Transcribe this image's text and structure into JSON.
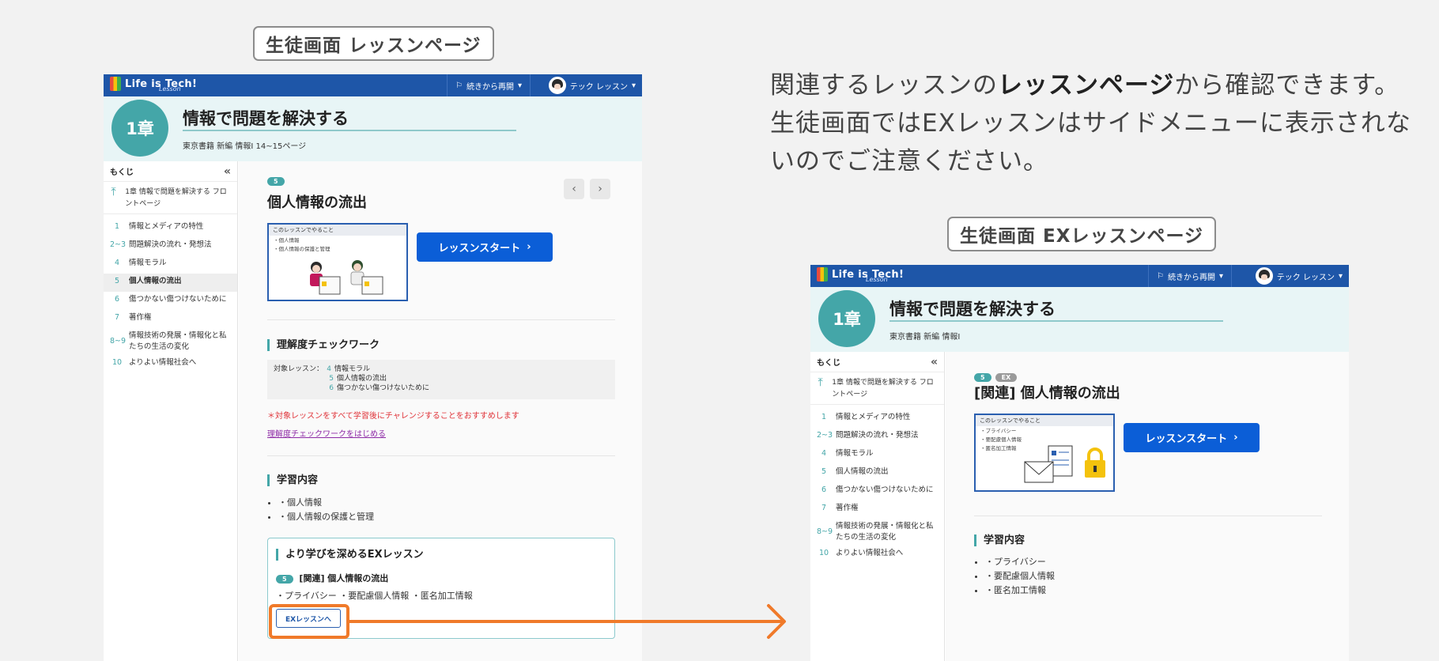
{
  "captions": {
    "left": "生徒画面 レッスンページ",
    "right": "生徒画面 EXレッスンページ"
  },
  "description": {
    "pre": "関連するレッスンの",
    "bold": "レッスンページ",
    "post": "から確認できます。生徒画面ではEXレッスンはサイドメニューに表示されないのでご注意ください。"
  },
  "header": {
    "logo": "Life is Tech!",
    "logo_sub": "Lesson",
    "resume": "続きから再開",
    "user": "テック レッスン",
    "chapter": "1章",
    "chapter_title": "情報で問題を解決する"
  },
  "left": {
    "book": "東京書籍 新編 情報Ⅰ 14~15ページ",
    "lesson_num": "5",
    "lesson_title": "個人情報の流出",
    "thumb_title": "このレッスンでやること",
    "thumb_lines": [
      "・個人情報",
      "・個人情報の保護と管理"
    ],
    "start": "レッスンスタート",
    "check_title": "理解度チェックワーク",
    "target_label": "対象レッスン：",
    "targets": [
      {
        "num": "4",
        "name": "情報モラル"
      },
      {
        "num": "5",
        "name": "個人情報の流出"
      },
      {
        "num": "6",
        "name": "傷つかない傷つけないために"
      }
    ],
    "warning": "＊対象レッスンをすべて学習後にチャレンジすることをおすすめします",
    "check_link": "理解度チェックワークをはじめる",
    "content_title": "学習内容",
    "contents": [
      "・個人情報",
      "・個人情報の保護と管理"
    ],
    "ex_title": "より学びを深めるEXレッスン",
    "ex_num": "5",
    "ex_lesson": "[関連] 個人情報の流出",
    "ex_tags": "・プライバシー ・要配慮個人情報 ・匿名加工情報",
    "ex_button": "EXレッスンへ"
  },
  "right": {
    "book": "東京書籍 新編 情報Ⅰ",
    "lesson_num": "5",
    "ex_badge": "EX",
    "lesson_title": "[関連] 個人情報の流出",
    "thumb_title": "このレッスンでやること",
    "thumb_lines": [
      "・プライバシー",
      "・要配慮個人情報",
      "・匿名加工情報"
    ],
    "start": "レッスンスタート",
    "content_title": "学習内容",
    "contents": [
      "・プライバシー",
      "・要配慮個人情報",
      "・匿名加工情報"
    ]
  },
  "sidebar": {
    "heading": "もくじ",
    "front": "1章 情報で問題を解決する フロントページ",
    "items": [
      {
        "num": "1",
        "label": "情報とメディアの特性"
      },
      {
        "num": "2~3",
        "label": "問題解決の流れ・発想法"
      },
      {
        "num": "4",
        "label": "情報モラル"
      },
      {
        "num": "5",
        "label": "個人情報の流出"
      },
      {
        "num": "6",
        "label": "傷つかない傷つけないために"
      },
      {
        "num": "7",
        "label": "著作権"
      },
      {
        "num": "8~9",
        "label": "情報技術の発展・情報化と私たちの生活の変化"
      },
      {
        "num": "10",
        "label": "よりよい情報社会へ"
      }
    ]
  },
  "colors": {
    "topbar": "#1e56a8",
    "accent": "#44a6a8",
    "primary_button": "#0b5ed7",
    "highlight": "#f07a2a"
  }
}
